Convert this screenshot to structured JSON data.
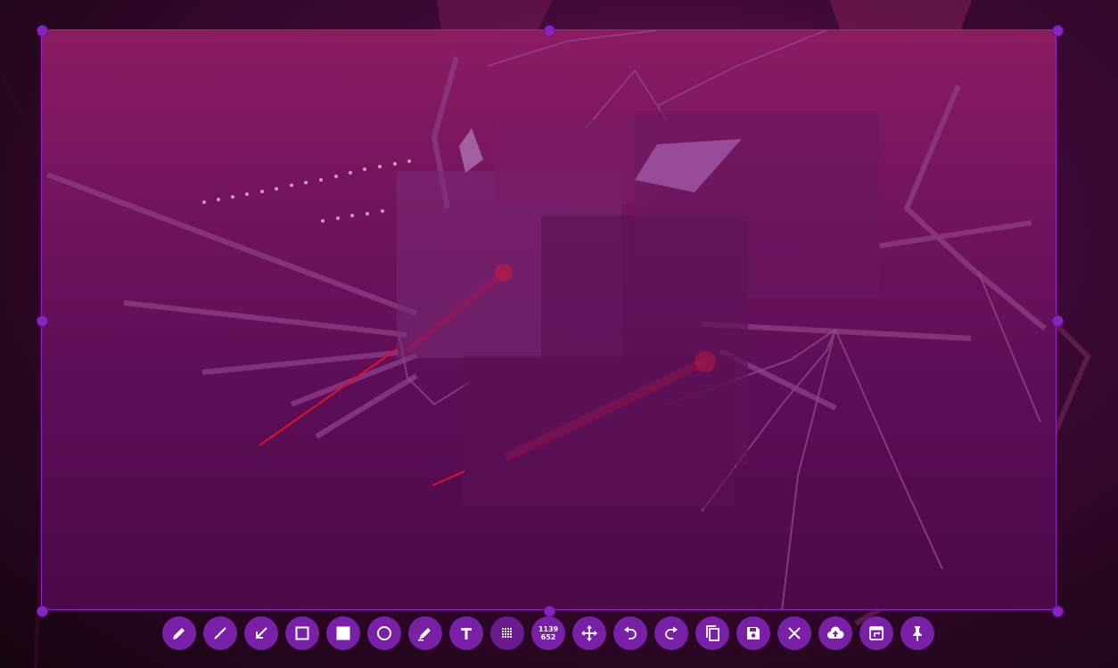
{
  "selection": {
    "width_label": "1139",
    "height_label": "652"
  },
  "toolbar": {
    "tools": [
      {
        "name": "pencil-tool",
        "icon": "pencil-icon"
      },
      {
        "name": "line-tool",
        "icon": "line-icon"
      },
      {
        "name": "arrow-tool",
        "icon": "arrow-icon"
      },
      {
        "name": "rectangle-tool",
        "icon": "rectangle-outline-icon"
      },
      {
        "name": "filled-rectangle-tool",
        "icon": "rectangle-filled-icon"
      },
      {
        "name": "circle-tool",
        "icon": "circle-icon"
      },
      {
        "name": "marker-tool",
        "icon": "marker-icon"
      },
      {
        "name": "text-tool",
        "icon": "text-icon"
      },
      {
        "name": "pixelate-tool",
        "icon": "pixelate-icon"
      },
      {
        "name": "selection-size-indicator",
        "icon": "size-indicator"
      },
      {
        "name": "move-selection-tool",
        "icon": "move-icon"
      },
      {
        "name": "undo-button",
        "icon": "undo-icon"
      },
      {
        "name": "redo-button",
        "icon": "redo-icon"
      },
      {
        "name": "copy-to-clipboard-button",
        "icon": "copy-icon"
      },
      {
        "name": "save-button",
        "icon": "save-icon"
      },
      {
        "name": "exit-button",
        "icon": "close-icon"
      },
      {
        "name": "upload-button",
        "icon": "cloud-upload-icon"
      },
      {
        "name": "open-with-app-button",
        "icon": "open-app-icon"
      },
      {
        "name": "pin-button",
        "icon": "pin-icon"
      }
    ]
  },
  "colors": {
    "accent": "#7a1fa8",
    "selection_border": "#9a1fd0",
    "handle": "#8a22c0",
    "drawing_red": "#e0102a"
  }
}
